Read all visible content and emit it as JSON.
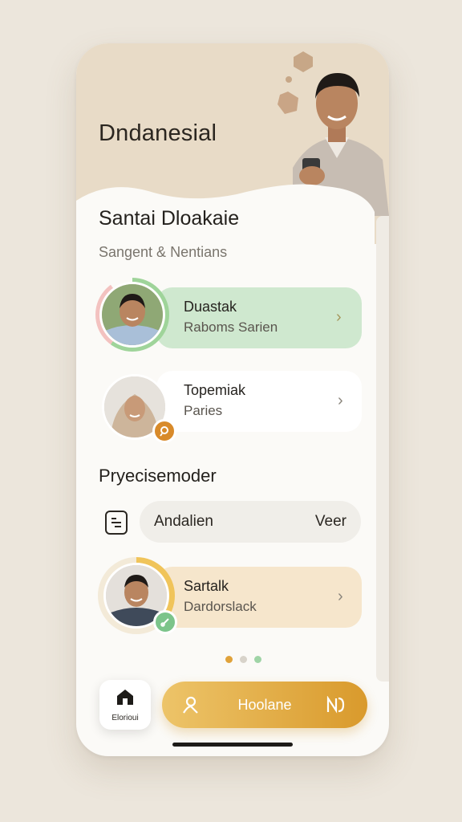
{
  "header": {
    "app_title": "Dndanesial"
  },
  "section1": {
    "title": "Santai Dloakaie",
    "subtitle": "Sangent & Nentians"
  },
  "contacts": [
    {
      "name": "Duastak",
      "detail": "Raboms Sarien",
      "accent": "#cfe8cf"
    },
    {
      "name": "Topemiak",
      "detail": "Paries",
      "accent": "#ffffff"
    }
  ],
  "section2": {
    "title": "Pryecisemoder"
  },
  "mode_pill": {
    "label": "Andalien",
    "action": "Veer"
  },
  "contact3": {
    "name": "Sartalk",
    "detail": "Dardorslack",
    "accent": "#f6e6cc"
  },
  "bottom": {
    "home_label": "Elorioui",
    "main_button_label": "Hoolane"
  },
  "colors": {
    "brand": "#d99a2c",
    "green": "#7cc48a",
    "hero": "#e8dbc7"
  }
}
